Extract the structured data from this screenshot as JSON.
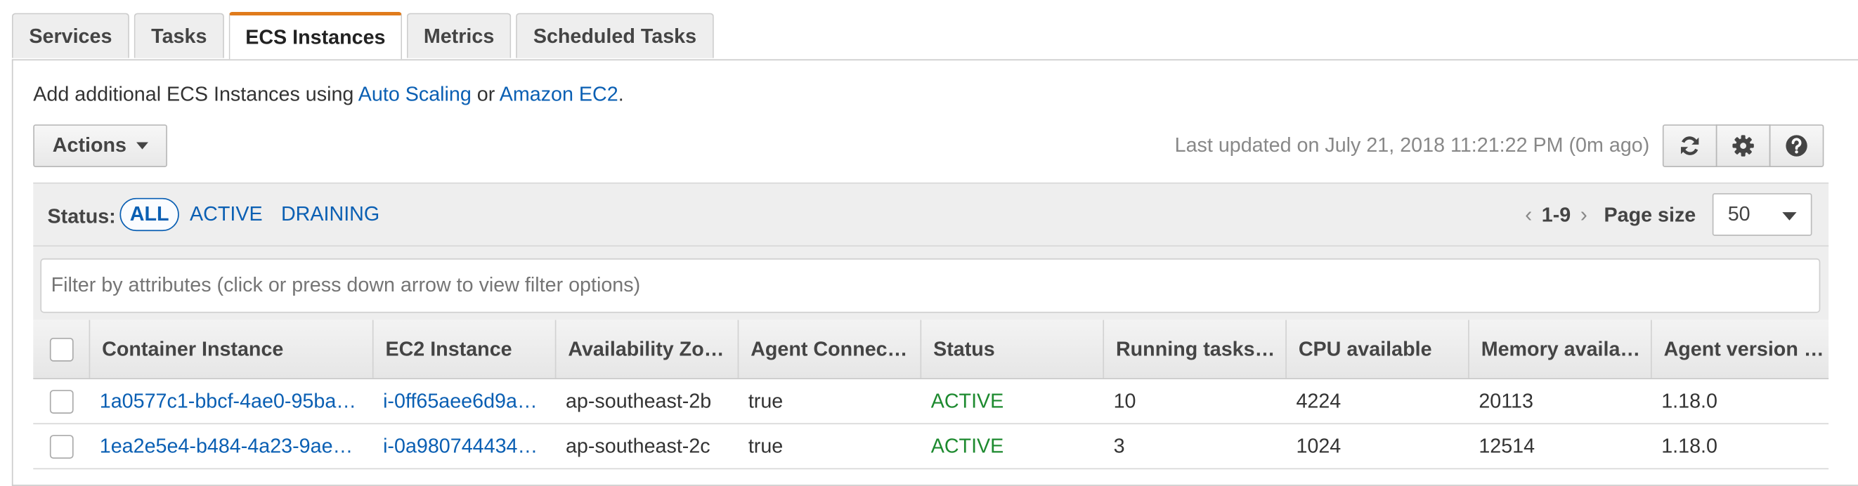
{
  "tabs": [
    {
      "label": "Services",
      "active": false
    },
    {
      "label": "Tasks",
      "active": false
    },
    {
      "label": "ECS Instances",
      "active": true
    },
    {
      "label": "Metrics",
      "active": false
    },
    {
      "label": "Scheduled Tasks",
      "active": false
    }
  ],
  "intro": {
    "prefix": "Add additional ECS Instances using ",
    "link1": "Auto Scaling",
    "middle": " or ",
    "link2": "Amazon EC2",
    "suffix": "."
  },
  "toolbar": {
    "actions_label": "Actions",
    "last_updated": "Last updated on July 21, 2018 11:21:22 PM (0m ago)",
    "icons": [
      "refresh-icon",
      "gear-icon",
      "help-icon"
    ]
  },
  "status_filter": {
    "label": "Status:",
    "options": [
      "ALL",
      "ACTIVE",
      "DRAINING"
    ],
    "selected": "ALL"
  },
  "pagination": {
    "prev": "‹",
    "range": "1-9",
    "next": "›",
    "page_size_label": "Page size",
    "page_size": "50"
  },
  "filter": {
    "placeholder": "Filter by attributes (click or press down arrow to view filter options)"
  },
  "table": {
    "columns": [
      "Container Instance",
      "EC2 Instance",
      "Availability Zo…",
      "Agent Connec…",
      "Status",
      "Running tasks…",
      "CPU available",
      "Memory availa…",
      "Agent version …"
    ],
    "rows": [
      [
        "1a0577c1-bbcf-4ae0-95ba…",
        "i-0ff65aee6d9a…",
        "ap-southeast-2b",
        "true",
        "ACTIVE",
        "10",
        "4224",
        "20113",
        "1.18.0"
      ],
      [
        "1ea2e5e4-b484-4a23-9ae…",
        "i-0a980744434…",
        "ap-southeast-2c",
        "true",
        "ACTIVE",
        "3",
        "1024",
        "12514",
        "1.18.0"
      ]
    ]
  },
  "colors": {
    "accent_tab": "#e07b1c",
    "link": "#0a5fb3",
    "status_active": "#1d8a2f"
  }
}
